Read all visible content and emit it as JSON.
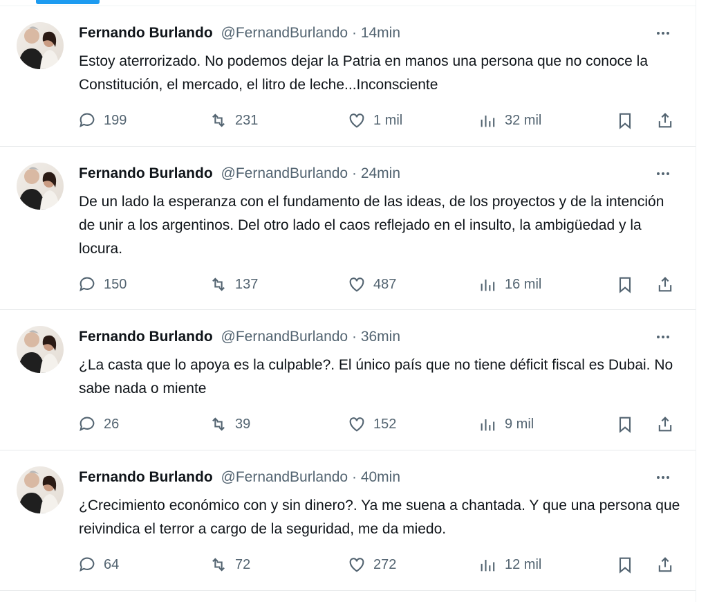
{
  "tweets": [
    {
      "name": "Fernando Burlando",
      "handle": "@FernandBurlando",
      "separator": "·",
      "time": "14min",
      "text": "Estoy aterrorizado. No podemos dejar la Patria en manos una persona que no conoce la Constitución, el mercado, el litro de leche...Inconsciente",
      "replies": "199",
      "retweets": "231",
      "likes": "1 mil",
      "views": "32 mil"
    },
    {
      "name": "Fernando Burlando",
      "handle": "@FernandBurlando",
      "separator": "·",
      "time": "24min",
      "text": "De un lado la esperanza con el fundamento de las  ideas, de los proyectos y de la intención de unir a los argentinos. Del otro lado el caos reflejado en el insulto, la ambigüedad y la locura.",
      "replies": "150",
      "retweets": "137",
      "likes": "487",
      "views": "16 mil"
    },
    {
      "name": "Fernando Burlando",
      "handle": "@FernandBurlando",
      "separator": "·",
      "time": "36min",
      "text": "¿La casta que lo apoya es la culpable?. El único país que no tiene déficit fiscal es Dubai. No sabe nada o miente",
      "replies": "26",
      "retweets": "39",
      "likes": "152",
      "views": "9 mil"
    },
    {
      "name": "Fernando Burlando",
      "handle": "@FernandBurlando",
      "separator": "·",
      "time": "40min",
      "text": "¿Crecimiento económico con y sin dinero?. Ya me suena a chantada. Y que una persona que reivindica el terror a cargo de la seguridad,  me da miedo.",
      "replies": "64",
      "retweets": "72",
      "likes": "272",
      "views": "12 mil"
    }
  ],
  "icons": {
    "reply": "reply-icon",
    "retweet": "retweet-icon",
    "like": "heart-icon",
    "views": "views-chart-icon",
    "bookmark": "bookmark-icon",
    "share": "share-icon",
    "more": "more-options-icon"
  },
  "colors": {
    "accent": "#1d9bf0",
    "text": "#0f1419",
    "secondary": "#536471",
    "divider": "#e7e9ea"
  }
}
